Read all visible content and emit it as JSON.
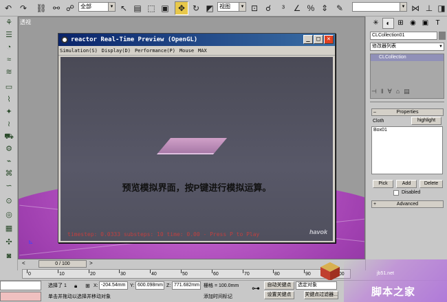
{
  "toolbar": {
    "selection_filter": "全部",
    "ref_coord": "视图",
    "named_selection": ""
  },
  "viewport": {
    "label": "透视"
  },
  "reactor_window": {
    "title": "reactor Real-Time Preview (OpenGL)",
    "menu": [
      "Simulation(S)",
      "Display(D)",
      "Performance(P)",
      "Mouse",
      "MAX"
    ],
    "caption": "预览模拟界面，按P键进行模拟运算。",
    "status": "timestep: 0.0333 substeps: 10 time: 0.00 - Press P to Play",
    "logo": "havok"
  },
  "command_panel": {
    "object_name": "CLCollection01",
    "modifier_list": "修改器列表",
    "stack_item": "CLCollection",
    "properties_title": "Properties",
    "cloth_label": "Cloth",
    "highlight_button": "highlight",
    "list_item": "Box01",
    "pick_button": "Pick",
    "add_button": "Add",
    "delete_button": "Delete",
    "disabled_label": "Disabled",
    "advanced_title": "Advanced"
  },
  "timeline": {
    "frame_display": "0 / 100",
    "ticks": [
      "0",
      "10",
      "20",
      "30",
      "40",
      "50",
      "60",
      "70",
      "80",
      "90",
      "100"
    ]
  },
  "statusbar": {
    "selected": "选择了 1",
    "x_label": "X:",
    "x_value": "-204.54mm",
    "y_label": "Y:",
    "y_value": "600.098mm",
    "z_label": "Z:",
    "z_value": "771.682mm",
    "grid": "栅格 = 100.0mm",
    "auto_key": "自动关键点",
    "set_key": "设置关键点",
    "key_mode": "选定对象",
    "key_filters": "关键点过滤器...",
    "prompt": "单击并拖动以选择并移动对象",
    "add_time_tag": "添加时间标记"
  },
  "watermark": {
    "site": "jb51.net",
    "name": "脚本之家"
  }
}
